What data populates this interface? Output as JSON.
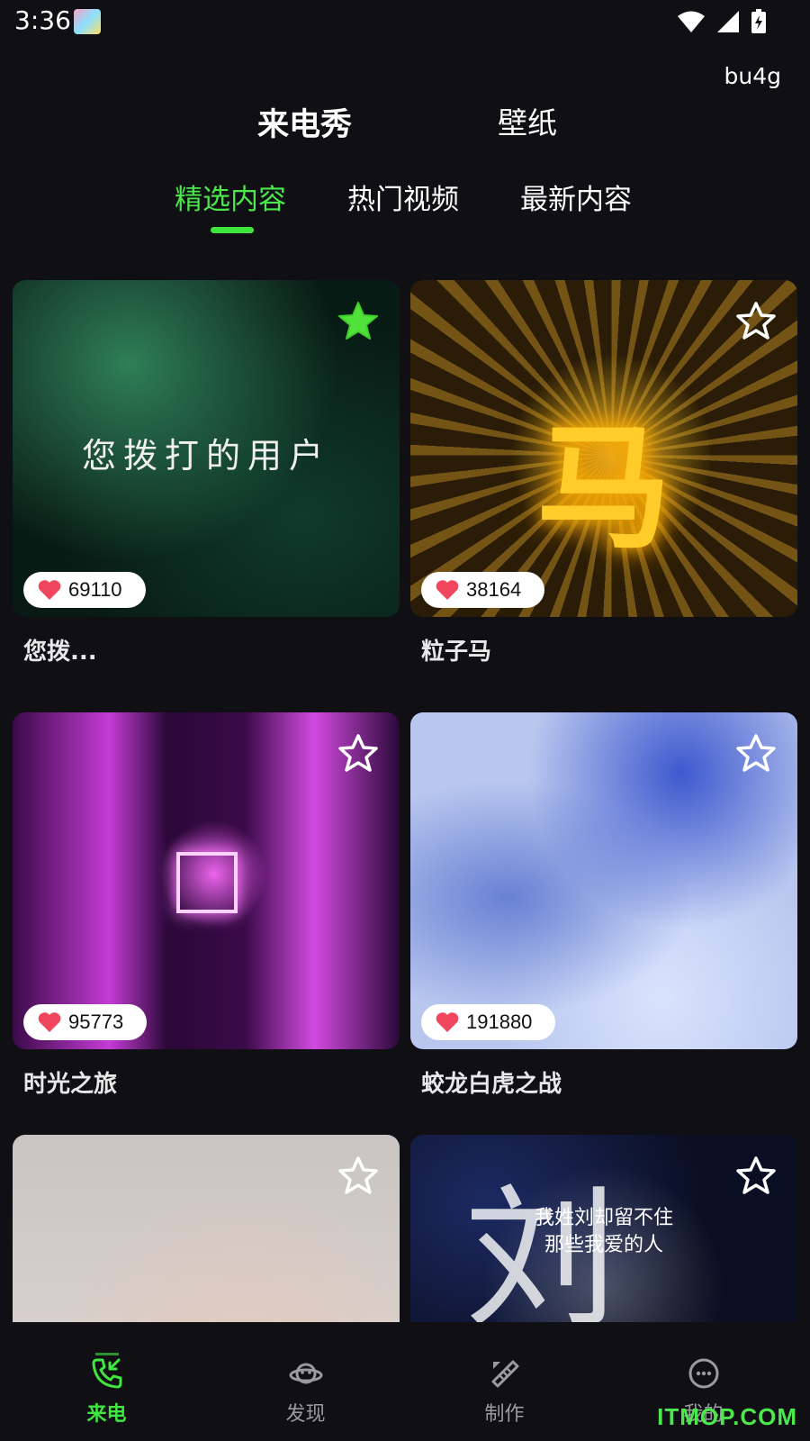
{
  "status_bar": {
    "time": "3:36"
  },
  "header": {
    "user_id": "bu4g",
    "top_tabs": [
      "来电秀",
      "壁纸"
    ],
    "sub_tabs": [
      "精选内容",
      "热门视频",
      "最新内容"
    ]
  },
  "cards": [
    {
      "title": "您拨...",
      "likes": "69110",
      "overlay_text": "您拨打的用户",
      "favorited": true
    },
    {
      "title": "粒子马",
      "likes": "38164",
      "overlay_text": "马",
      "favorited": false
    },
    {
      "title": "时光之旅",
      "likes": "95773",
      "favorited": false
    },
    {
      "title": "蛟龙白虎之战",
      "likes": "191880",
      "favorited": false
    },
    {
      "favorited": false
    },
    {
      "overlay_text": "我姓刘却留不住\n那些我爱的人",
      "big_char": "刘",
      "favorited": false
    }
  ],
  "bottom_nav": [
    "来电",
    "发现",
    "制作",
    "我的"
  ],
  "watermark": "ITMOP.COM",
  "colors": {
    "accent": "#3ee63e",
    "background": "#0f0f14",
    "like_heart": "#f0475e"
  },
  "icons": {
    "nav": [
      "phone-incoming-icon",
      "planet-icon",
      "ruler-pencil-icon",
      "smile-face-icon"
    ],
    "card": [
      "star-icon",
      "heart-icon"
    ],
    "status": [
      "wifi-icon",
      "signal-icon",
      "battery-charging-icon"
    ]
  }
}
